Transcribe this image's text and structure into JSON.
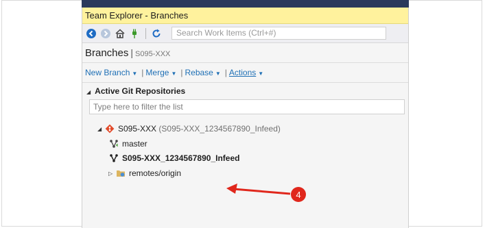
{
  "window": {
    "title": "Team Explorer - Branches"
  },
  "toolbar": {
    "icons": [
      "back-icon",
      "forward-icon",
      "home-icon",
      "connect-icon",
      "refresh-icon"
    ],
    "search_placeholder": "Search Work Items (Ctrl+#)"
  },
  "header": {
    "title": "Branches",
    "separator": "|",
    "repo": "S095-XXX"
  },
  "actions": {
    "new_branch": "New Branch",
    "merge": "Merge",
    "rebase": "Rebase",
    "actions": "Actions",
    "separator": "|"
  },
  "section": {
    "title": "Active Git Repositories"
  },
  "filter": {
    "placeholder": "Type here to filter the list",
    "value": ""
  },
  "tree": {
    "repo": {
      "name": "S095-XXX",
      "detail": "(S095-XXX_1234567890_Infeed)"
    },
    "branches": [
      {
        "name": "master",
        "current": false
      },
      {
        "name": "S095-XXX_1234567890_Infeed",
        "current": true
      }
    ],
    "remotes": {
      "name": "remotes/origin"
    }
  },
  "callout": {
    "number": "4",
    "color": "#e0271c"
  },
  "colors": {
    "title_bar": "#fff29d",
    "link": "#1e6fb5",
    "top_strip": "#2b3a5c"
  }
}
